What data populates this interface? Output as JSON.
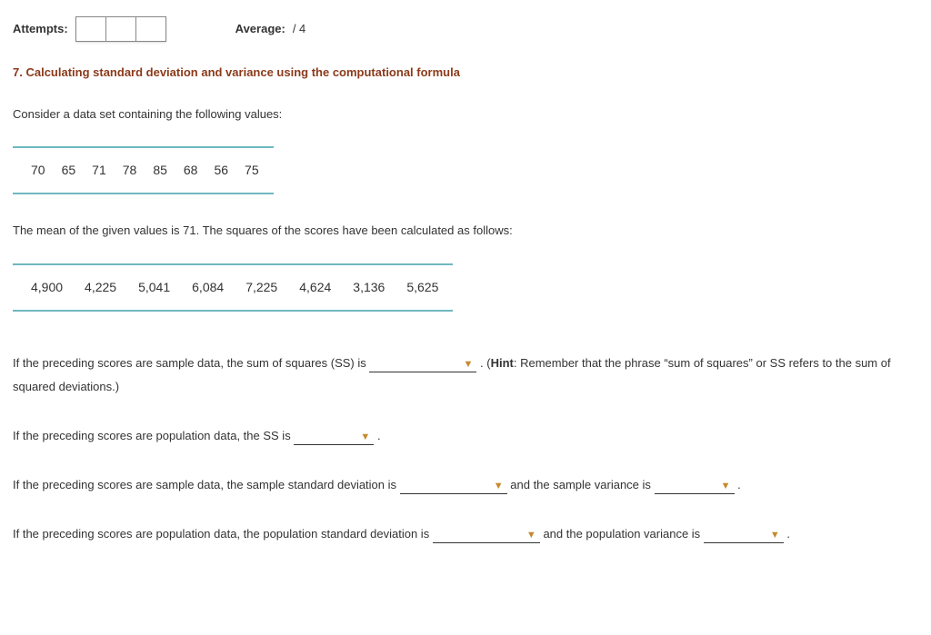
{
  "header": {
    "attempts_label": "Attempts:",
    "average_label": "Average:",
    "average_value": "/ 4"
  },
  "question": {
    "number": "7.",
    "title": "Calculating standard deviation and variance using the computational formula"
  },
  "intro": "Consider a data set containing the following values:",
  "values": [
    "70",
    "65",
    "71",
    "78",
    "85",
    "68",
    "56",
    "75"
  ],
  "mean_text": "The mean of the given values is 71. The squares of the scores have been calculated as follows:",
  "squares": [
    "4,900",
    "4,225",
    "5,041",
    "6,084",
    "7,225",
    "4,624",
    "3,136",
    "5,625"
  ],
  "q1": {
    "pre": "If the preceding scores are sample data, the sum of squares (SS) is ",
    "post_dot": " .",
    "hint_open": " (",
    "hint_label": "Hint",
    "hint_body": ": Remember that the phrase “sum of squares” or SS refers to the sum of squared deviations.)"
  },
  "q2": {
    "pre": "If the preceding scores are population data, the SS is ",
    "post": " ."
  },
  "q3": {
    "pre": "If the preceding scores are sample data, the sample standard deviation is ",
    "mid": "  and the sample variance is ",
    "post": " ."
  },
  "q4": {
    "pre": "If the preceding scores are population data, the population standard deviation is ",
    "mid": "  and the population variance is ",
    "post": " ."
  }
}
